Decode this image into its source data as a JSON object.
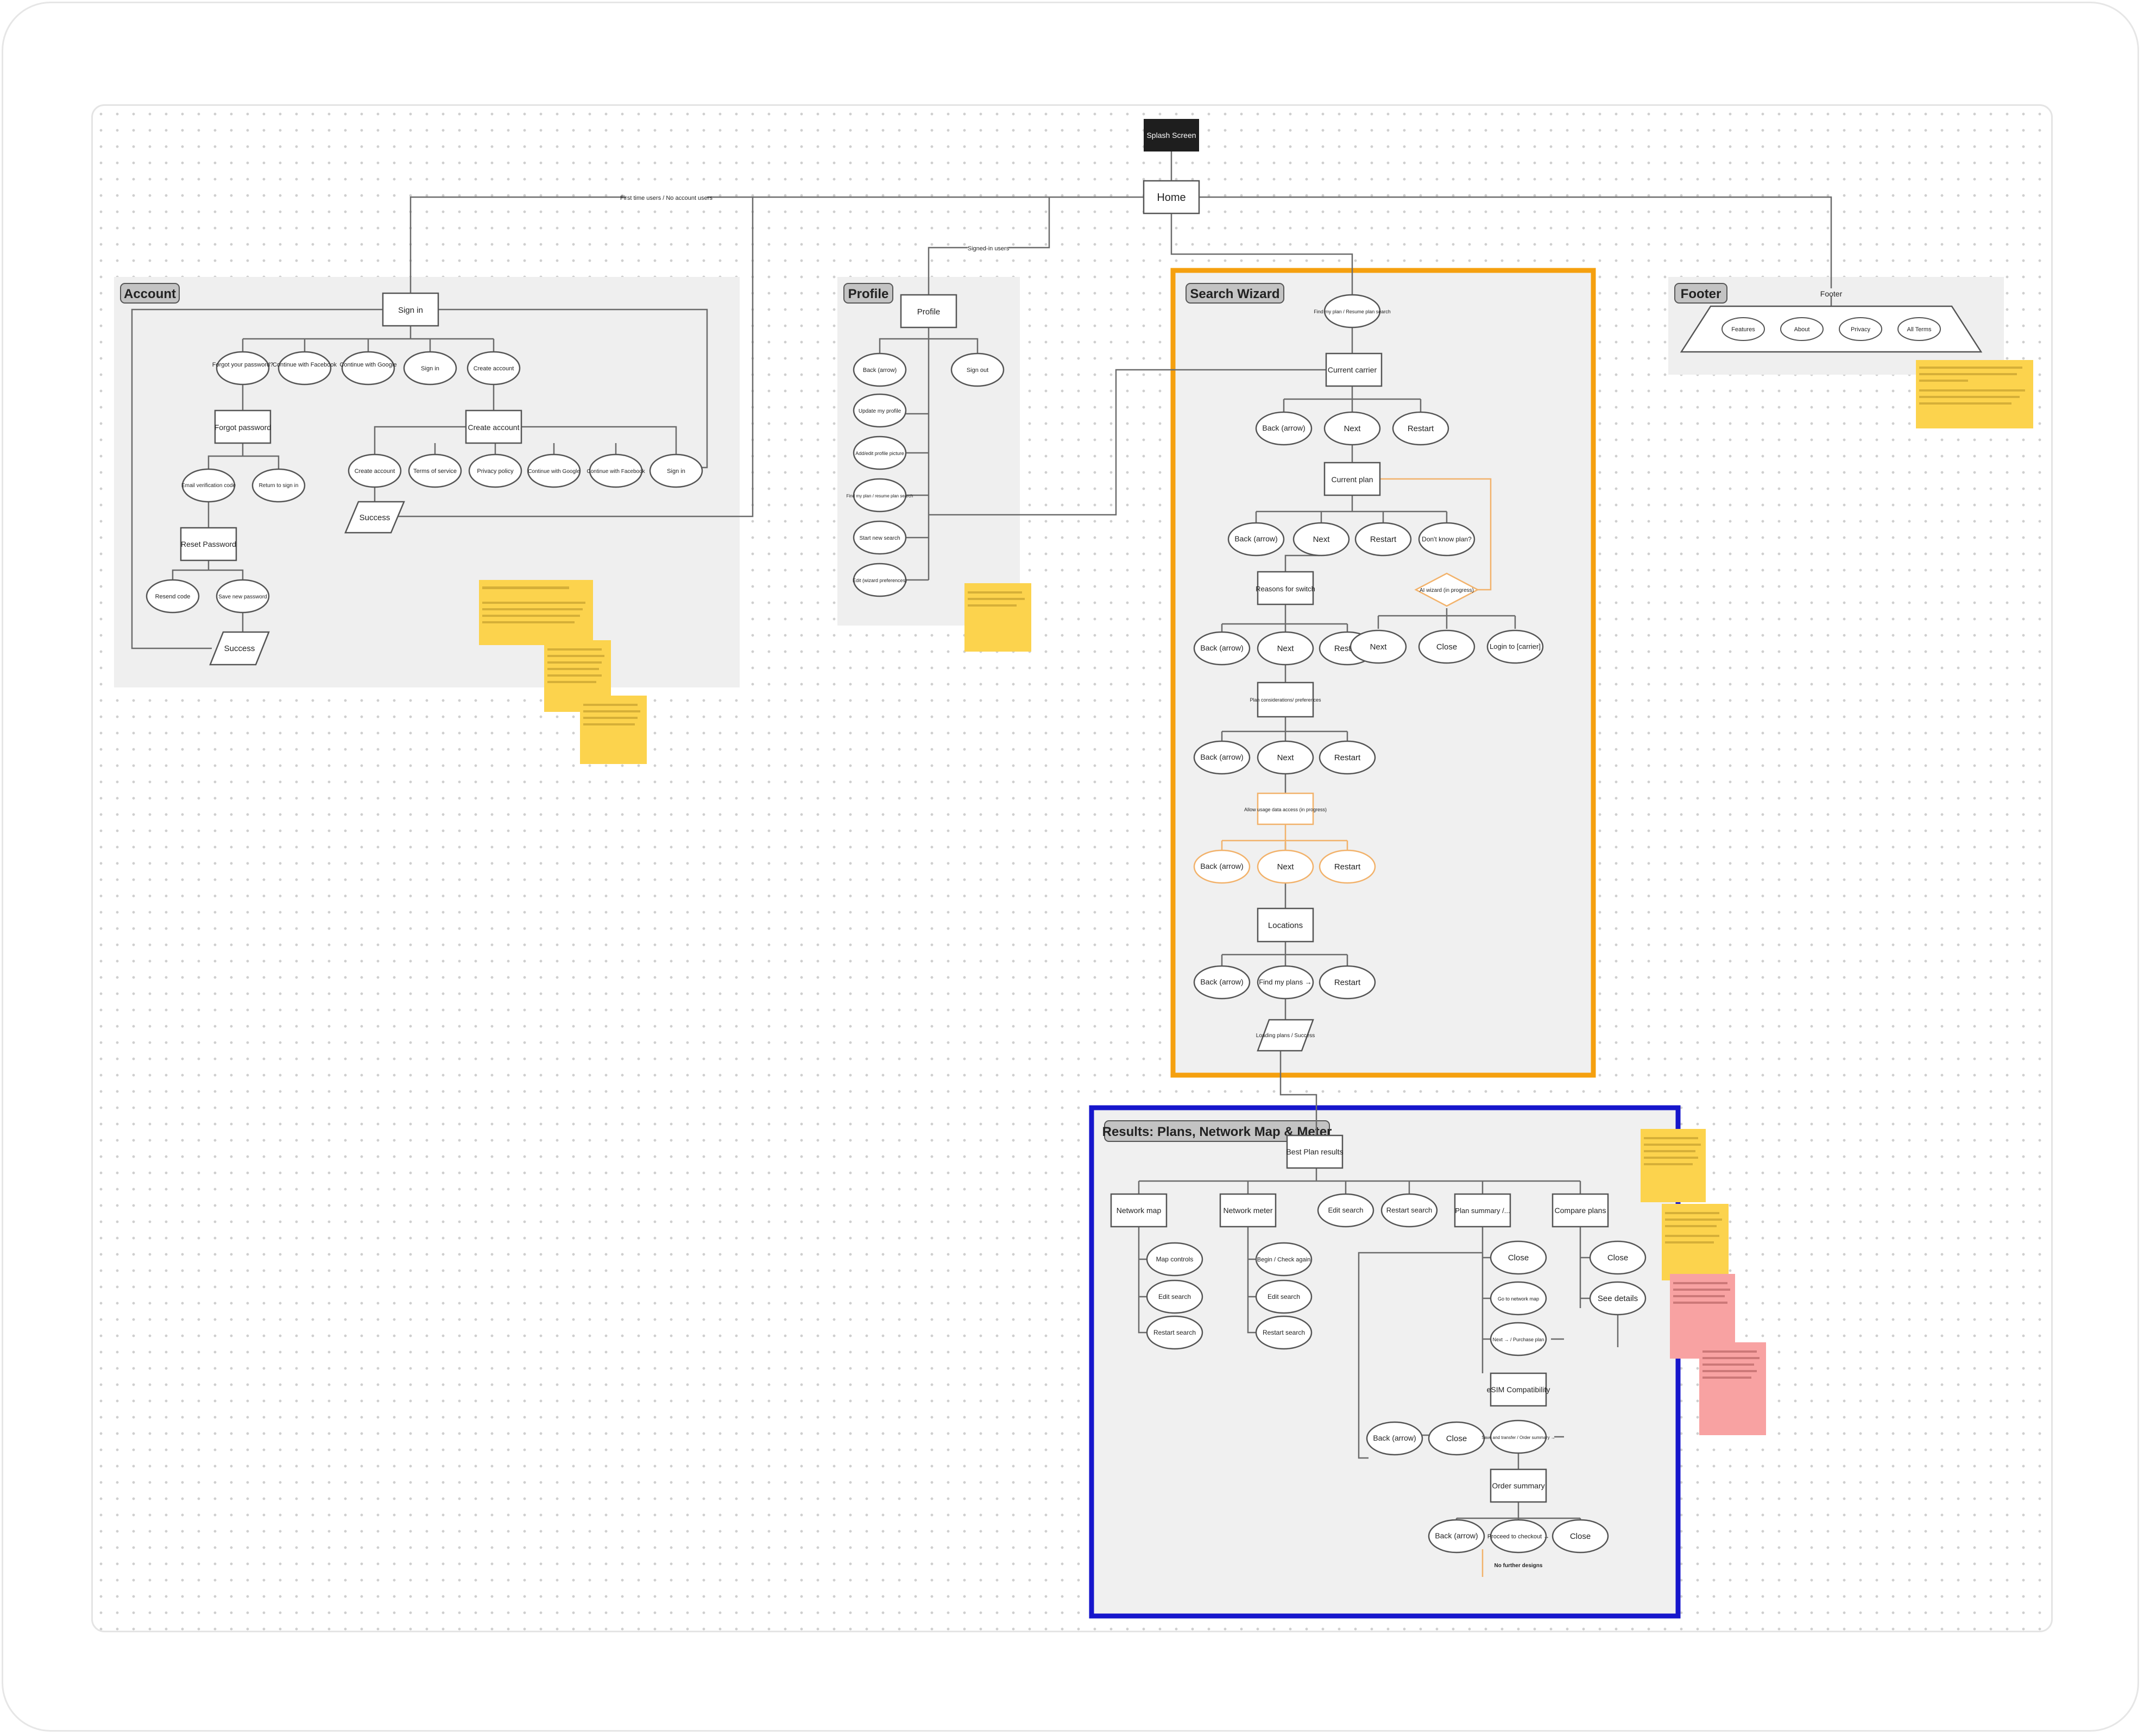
{
  "sections": {
    "account": "Account",
    "profile": "Profile",
    "search": "Search Wizard",
    "footer": "Footer",
    "results": "Results: Plans, Network Map & Meter"
  },
  "top": {
    "splash": "Splash Screen",
    "home": "Home",
    "first_time_label": "First time users / No account users",
    "signed_in_label": "Signed-in users"
  },
  "account": {
    "sign_in": "Sign in",
    "forgot": "Forgot your password?",
    "continue_facebook": "Continue with Facebook",
    "continue_google": "Continue with Google",
    "sign_in_2": "Sign in",
    "create_account": "Create account",
    "forgot_password": "Forgot password",
    "create_account_box": "Create account",
    "email_code": "Email verification code",
    "return_sign_in": "Return to sign in",
    "create_account_2": "Create account",
    "terms": "Terms of service",
    "privacy": "Privacy policy",
    "continue_google_2": "Continue with Google",
    "continue_facebook_2": "Continue with Facebook",
    "sign_in_3": "Sign in",
    "success_1": "Success",
    "reset_password": "Reset Password",
    "resend_code": "Resend code",
    "save_new_password": "Save new password",
    "success_2": "Success"
  },
  "profile": {
    "profile": "Profile",
    "back": "Back (arrow)",
    "sign_out": "Sign out",
    "update": "Update my profile",
    "add_edit_pic": "Add/edit profile picture",
    "find_plan": "Find my plan / resume plan search",
    "start_new": "Start new search",
    "edit_prefs": "Edit (wizard preferences)"
  },
  "wizard": {
    "find_plan": "Find my plan / Resume plan search",
    "current_carrier": "Current carrier",
    "back": "Back (arrow)",
    "next": "Next",
    "restart": "Restart",
    "current_plan": "Current plan",
    "dont_know": "Don't know plan?",
    "ai_wizard": "AI wizard (in progress)",
    "reasons": "Reasons for switch",
    "close": "Close",
    "login_carrier": "Login to [carrier]",
    "plan_considerations": "Plan considerations/ preferences",
    "allow_usage": "Allow usage data access (in progress)",
    "locations": "Locations",
    "find_my_plans": "Find my plans →",
    "loading": "Loading plans / Success"
  },
  "footer": {
    "title": "Footer",
    "features": "Features",
    "about": "About",
    "privacy": "Privacy",
    "all_terms": "All Terms"
  },
  "results": {
    "best_plan": "Best Plan results",
    "network_map": "Network map",
    "network_meter": "Network meter",
    "edit_search": "Edit search",
    "restart_search": "Restart search",
    "plan_summary": "Plan summary /...",
    "compare_plans": "Compare plans",
    "map_controls": "Map controls",
    "edit_search_2": "Edit search",
    "restart_search_2": "Restart search",
    "begin_check": "Begin / Check again",
    "edit_search_3": "Edit search",
    "restart_search_3": "Restart search",
    "close": "Close",
    "go_network_map": "Go to network map",
    "next_purchase": "Next → / Purchase plan",
    "close_2": "Close",
    "see_details": "See details",
    "esim": "eSIM Compatibility",
    "back": "Back (arrow)",
    "close_3": "Close",
    "save_proceed": "Save and transfer / Order summary →",
    "order_summary": "Order summary",
    "back_2": "Back (arrow)",
    "proceed_checkout": "Proceed to checkout →",
    "close_4": "Close",
    "no_further": "No further designs"
  },
  "colors": {
    "search_border": "#f5a00f",
    "results_border": "#1616cc",
    "sticky_yellow": "#fcd34d",
    "sticky_pink": "#f8a2a2",
    "orange_node": "#f2b26b"
  }
}
